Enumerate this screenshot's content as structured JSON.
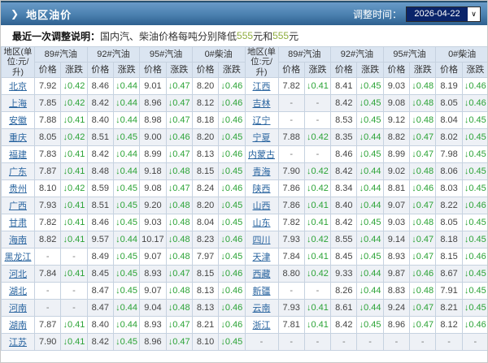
{
  "header": {
    "arrow": "❯",
    "title": "地区油价",
    "adjust_label": "调整时间：",
    "date": "2026-04-22",
    "select_arrow": "∨"
  },
  "notice": {
    "label": "最近一次调整说明：",
    "text_before": "国内汽、柴油价格每吨分别降低",
    "value1": "555",
    "text_mid": "元和",
    "value2": "555",
    "text_after": "元"
  },
  "colors": {
    "titlebar_top": "#699bc8",
    "titlebar_bottom": "#2e608f",
    "header_cell_bg": "#dbe5f1",
    "stripe_bg": "#eef1f6",
    "link_blue": "#2a65a0",
    "down_green": "#2ba336",
    "notice_green": "#8fad3f",
    "select_bg": "#0a246a"
  },
  "table": {
    "region_header": "地区(单位:元/升)",
    "fuel_types": [
      "89#汽油",
      "92#汽油",
      "95#汽油",
      "0#柴油"
    ],
    "price_label": "价格",
    "change_label": "涨跌",
    "down_arrow": "↓",
    "rows": [
      [
        "北京",
        "7.92",
        "0.42",
        "8.46",
        "0.44",
        "9.01",
        "0.47",
        "8.20",
        "0.46",
        "江西",
        "7.82",
        "0.41",
        "8.41",
        "0.45",
        "9.03",
        "0.48",
        "8.19",
        "0.46"
      ],
      [
        "上海",
        "7.85",
        "0.42",
        "8.42",
        "0.44",
        "8.96",
        "0.47",
        "8.12",
        "0.46",
        "吉林",
        "-",
        "-",
        "8.42",
        "0.45",
        "9.08",
        "0.48",
        "8.05",
        "0.46"
      ],
      [
        "安徽",
        "7.88",
        "0.41",
        "8.40",
        "0.44",
        "8.98",
        "0.47",
        "8.18",
        "0.46",
        "辽宁",
        "-",
        "-",
        "8.53",
        "0.45",
        "9.12",
        "0.48",
        "8.04",
        "0.45"
      ],
      [
        "重庆",
        "8.05",
        "0.42",
        "8.51",
        "0.45",
        "9.00",
        "0.46",
        "8.20",
        "0.45",
        "宁夏",
        "7.88",
        "0.42",
        "8.35",
        "0.44",
        "8.82",
        "0.47",
        "8.02",
        "0.45"
      ],
      [
        "福建",
        "7.83",
        "0.41",
        "8.42",
        "0.44",
        "8.99",
        "0.47",
        "8.13",
        "0.46",
        "内蒙古",
        "-",
        "-",
        "8.46",
        "0.45",
        "8.99",
        "0.47",
        "7.98",
        "0.45"
      ],
      [
        "广东",
        "7.87",
        "0.41",
        "8.48",
        "0.44",
        "9.18",
        "0.48",
        "8.15",
        "0.45",
        "青海",
        "7.90",
        "0.42",
        "8.42",
        "0.44",
        "9.02",
        "0.48",
        "8.06",
        "0.45"
      ],
      [
        "贵州",
        "8.10",
        "0.42",
        "8.59",
        "0.45",
        "9.08",
        "0.47",
        "8.24",
        "0.46",
        "陕西",
        "7.86",
        "0.42",
        "8.34",
        "0.44",
        "8.81",
        "0.46",
        "8.03",
        "0.45"
      ],
      [
        "广西",
        "7.93",
        "0.41",
        "8.51",
        "0.45",
        "9.20",
        "0.48",
        "8.20",
        "0.45",
        "山西",
        "7.86",
        "0.41",
        "8.40",
        "0.44",
        "9.07",
        "0.47",
        "8.22",
        "0.46"
      ],
      [
        "甘肃",
        "7.82",
        "0.41",
        "8.46",
        "0.45",
        "9.03",
        "0.48",
        "8.04",
        "0.45",
        "山东",
        "7.82",
        "0.41",
        "8.42",
        "0.45",
        "9.03",
        "0.48",
        "8.05",
        "0.45"
      ],
      [
        "海南",
        "8.82",
        "0.41",
        "9.57",
        "0.44",
        "10.17",
        "0.48",
        "8.23",
        "0.46",
        "四川",
        "7.93",
        "0.42",
        "8.55",
        "0.44",
        "9.14",
        "0.47",
        "8.18",
        "0.45"
      ],
      [
        "黑龙江",
        "-",
        "-",
        "8.49",
        "0.45",
        "9.07",
        "0.48",
        "7.97",
        "0.45",
        "天津",
        "7.84",
        "0.41",
        "8.45",
        "0.45",
        "8.93",
        "0.47",
        "8.15",
        "0.46"
      ],
      [
        "河北",
        "7.84",
        "0.41",
        "8.45",
        "0.45",
        "8.93",
        "0.47",
        "8.15",
        "0.46",
        "西藏",
        "8.80",
        "0.42",
        "9.33",
        "0.44",
        "9.87",
        "0.46",
        "8.67",
        "0.45"
      ],
      [
        "湖北",
        "-",
        "-",
        "8.47",
        "0.45",
        "9.07",
        "0.48",
        "8.13",
        "0.46",
        "新疆",
        "-",
        "-",
        "8.26",
        "0.44",
        "8.83",
        "0.48",
        "7.91",
        "0.45"
      ],
      [
        "河南",
        "-",
        "-",
        "8.47",
        "0.44",
        "9.04",
        "0.48",
        "8.13",
        "0.46",
        "云南",
        "7.93",
        "0.41",
        "8.61",
        "0.44",
        "9.24",
        "0.47",
        "8.21",
        "0.45"
      ],
      [
        "湖南",
        "7.87",
        "0.41",
        "8.40",
        "0.44",
        "8.93",
        "0.47",
        "8.21",
        "0.46",
        "浙江",
        "7.81",
        "0.41",
        "8.42",
        "0.45",
        "8.96",
        "0.47",
        "8.12",
        "0.46"
      ],
      [
        "江苏",
        "7.90",
        "0.41",
        "8.42",
        "0.45",
        "8.96",
        "0.47",
        "8.10",
        "0.45",
        "-",
        "-",
        "-",
        "-",
        "-",
        "-",
        "-",
        "-",
        "-"
      ]
    ]
  }
}
